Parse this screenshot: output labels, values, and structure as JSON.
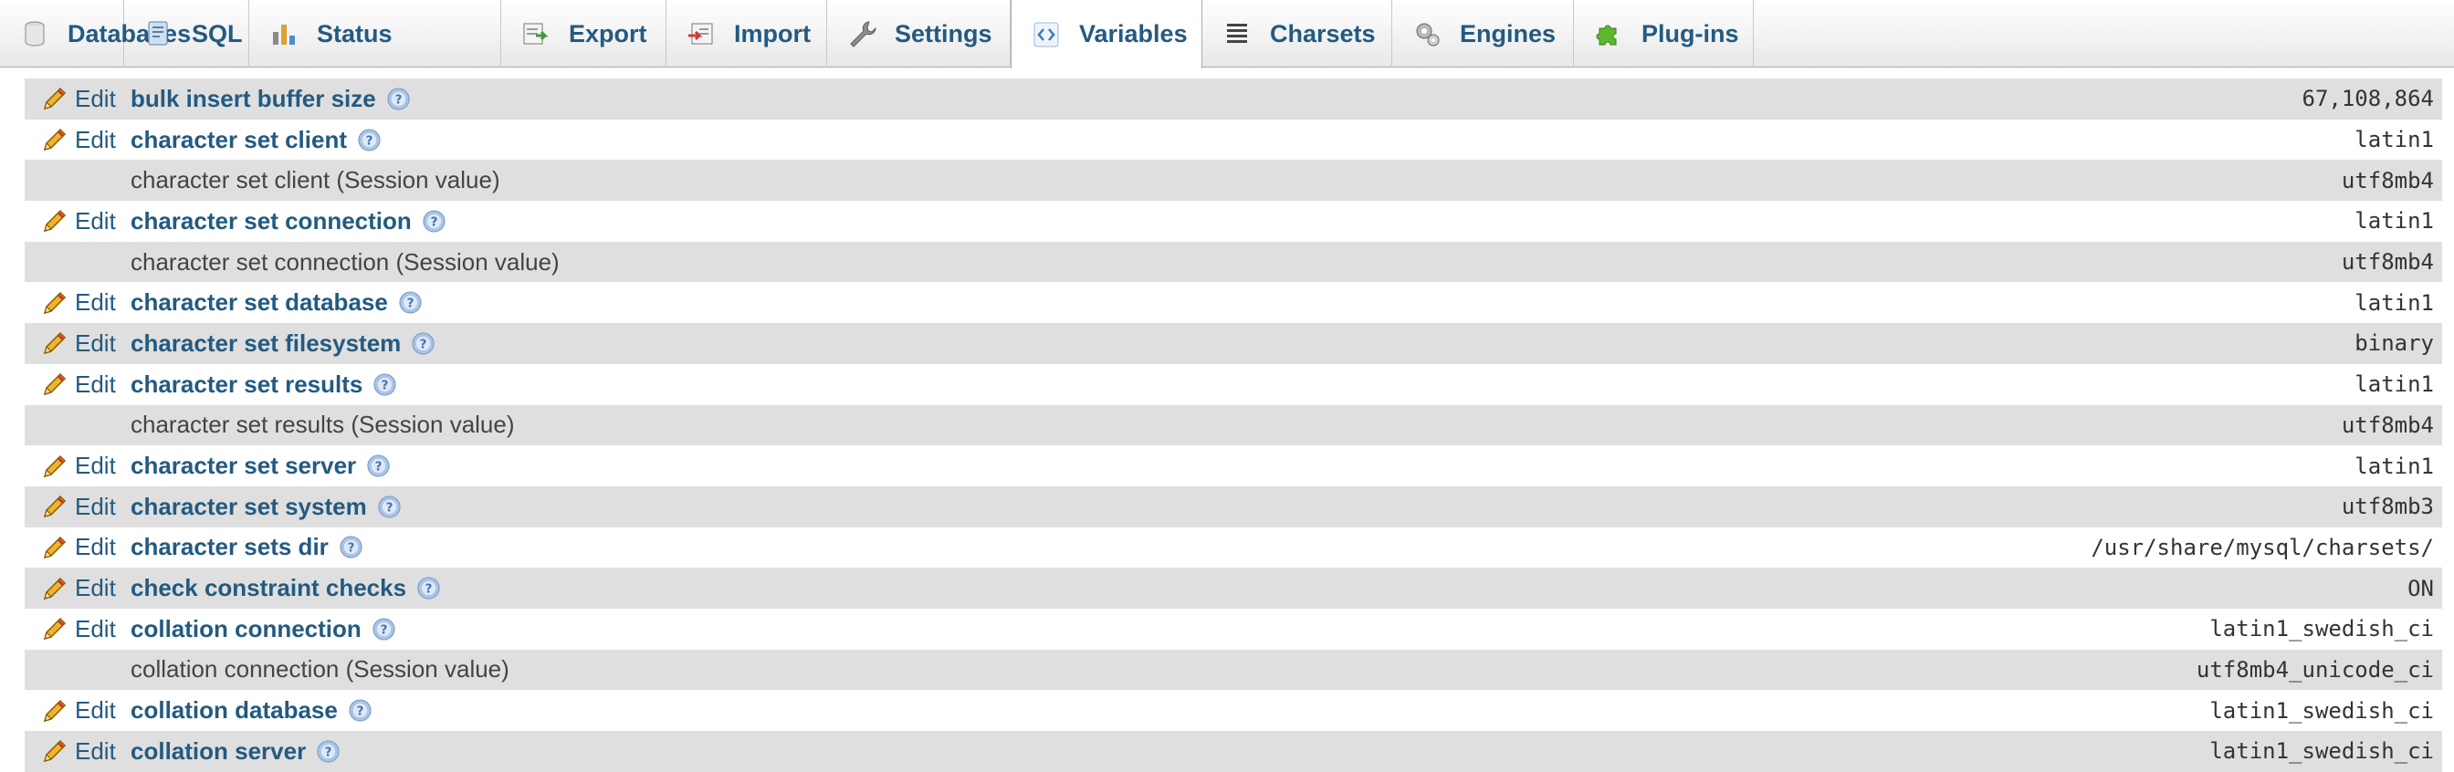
{
  "tabs": [
    {
      "label": "Databases",
      "icon": "database-icon",
      "active": false
    },
    {
      "label": "SQL",
      "icon": "sql-icon",
      "active": false
    },
    {
      "label": "Status",
      "icon": "status-icon",
      "active": false
    },
    {
      "label": "Export",
      "icon": "export-icon",
      "active": false
    },
    {
      "label": "Import",
      "icon": "import-icon",
      "active": false
    },
    {
      "label": "Settings",
      "icon": "wrench-icon",
      "active": false
    },
    {
      "label": "Variables",
      "icon": "variables-icon",
      "active": true
    },
    {
      "label": "Charsets",
      "icon": "charsets-icon",
      "active": false
    },
    {
      "label": "Engines",
      "icon": "engines-icon",
      "active": false
    },
    {
      "label": "Plug-ins",
      "icon": "puzzle-icon",
      "active": false
    }
  ],
  "edit_label": "Edit",
  "variables": [
    {
      "name": "bulk insert buffer size",
      "value": "67,108,864",
      "session": false
    },
    {
      "name": "character set client",
      "value": "latin1",
      "session": false
    },
    {
      "name": "character set client (Session value)",
      "value": "utf8mb4",
      "session": true
    },
    {
      "name": "character set connection",
      "value": "latin1",
      "session": false
    },
    {
      "name": "character set connection (Session value)",
      "value": "utf8mb4",
      "session": true
    },
    {
      "name": "character set database",
      "value": "latin1",
      "session": false
    },
    {
      "name": "character set filesystem",
      "value": "binary",
      "session": false
    },
    {
      "name": "character set results",
      "value": "latin1",
      "session": false
    },
    {
      "name": "character set results (Session value)",
      "value": "utf8mb4",
      "session": true
    },
    {
      "name": "character set server",
      "value": "latin1",
      "session": false
    },
    {
      "name": "character set system",
      "value": "utf8mb3",
      "session": false
    },
    {
      "name": "character sets dir",
      "value": "/usr/share/mysql/charsets/",
      "session": false
    },
    {
      "name": "check constraint checks",
      "value": "ON",
      "session": false
    },
    {
      "name": "collation connection",
      "value": "latin1_swedish_ci",
      "session": false
    },
    {
      "name": "collation connection (Session value)",
      "value": "utf8mb4_unicode_ci",
      "session": true
    },
    {
      "name": "collation database",
      "value": "latin1_swedish_ci",
      "session": false
    },
    {
      "name": "collation server",
      "value": "latin1_swedish_ci",
      "session": false
    }
  ],
  "colors": {
    "link": "#235a81",
    "row_shade": "#dfdfdf",
    "edit_pencil": "#e8a317"
  }
}
